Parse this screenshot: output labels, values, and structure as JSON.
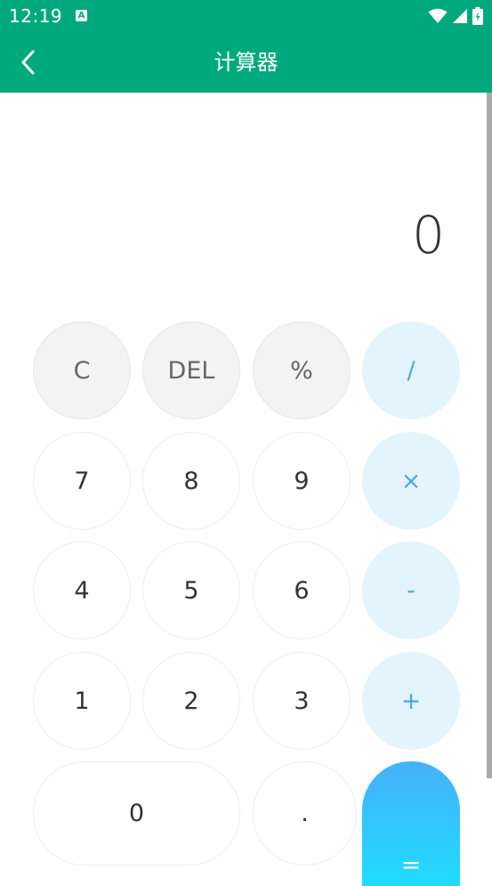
{
  "status_bar": {
    "time": "12:19",
    "notification_icon": "A",
    "icons": [
      "wifi-icon",
      "signal-icon",
      "battery-charging-icon"
    ]
  },
  "app_bar": {
    "title": "计算器",
    "back_icon": "chevron-left-icon"
  },
  "display": {
    "value": "0"
  },
  "keypad": {
    "clear": "C",
    "delete": "DEL",
    "percent": "%",
    "divide": "/",
    "seven": "7",
    "eight": "8",
    "nine": "9",
    "multiply": "×",
    "four": "4",
    "five": "5",
    "six": "6",
    "subtract": "-",
    "one": "1",
    "two": "2",
    "three": "3",
    "add": "+",
    "zero": "0",
    "decimal": ".",
    "equals": "="
  },
  "colors": {
    "primary": "#00a97d",
    "function_key_bg": "#f3f3f3",
    "operator_key_bg": "#e3f4fd",
    "operator_text": "#4aa6ea",
    "equals_gradient_top": "#46b0fb",
    "equals_gradient_bottom": "#1fdcfd"
  }
}
